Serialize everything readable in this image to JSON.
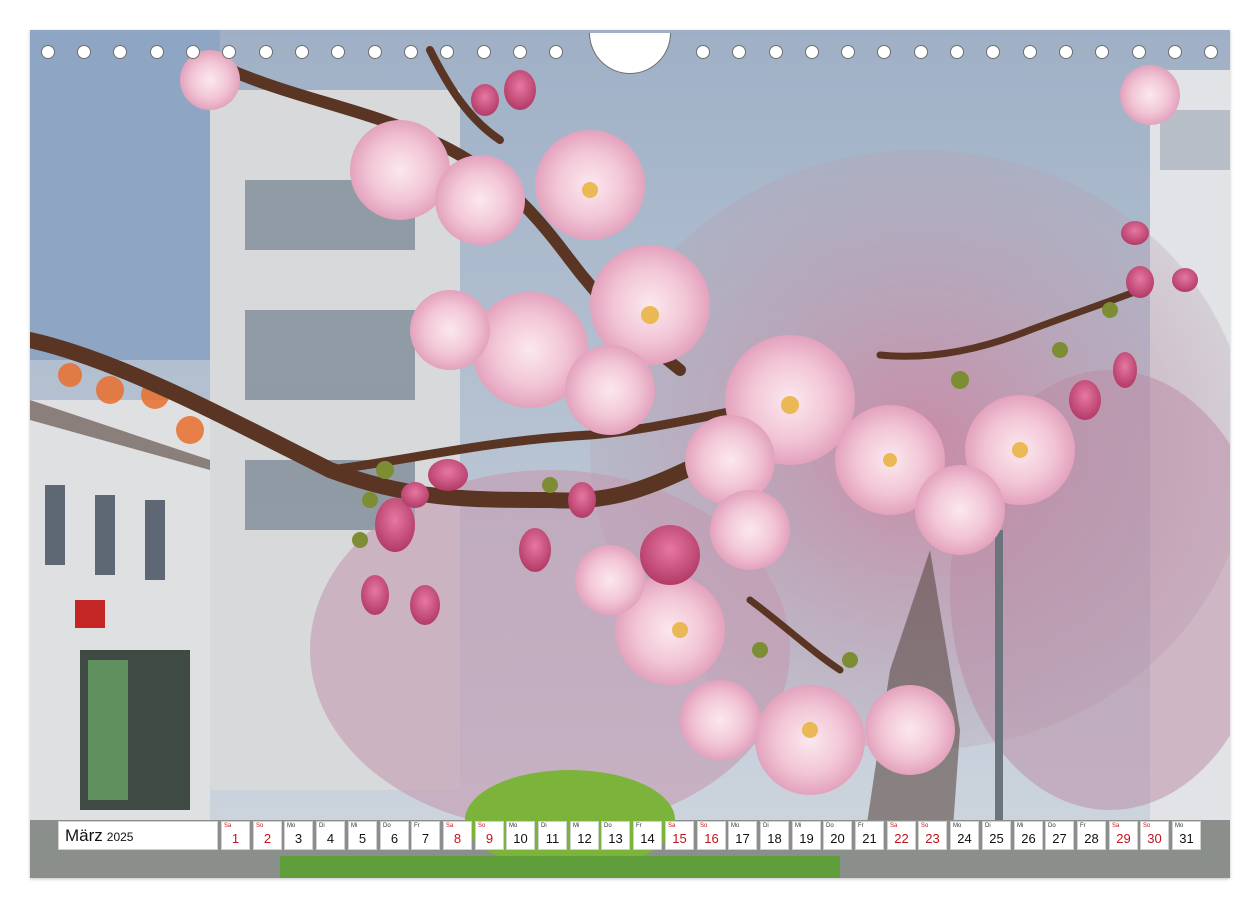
{
  "calendar": {
    "month": "März",
    "year": "2025",
    "days": [
      {
        "dow": "Sa",
        "num": "1",
        "weekend": true
      },
      {
        "dow": "So",
        "num": "2",
        "weekend": true
      },
      {
        "dow": "Mo",
        "num": "3",
        "weekend": false
      },
      {
        "dow": "Di",
        "num": "4",
        "weekend": false
      },
      {
        "dow": "Mi",
        "num": "5",
        "weekend": false
      },
      {
        "dow": "Do",
        "num": "6",
        "weekend": false
      },
      {
        "dow": "Fr",
        "num": "7",
        "weekend": false
      },
      {
        "dow": "Sa",
        "num": "8",
        "weekend": true
      },
      {
        "dow": "So",
        "num": "9",
        "weekend": true
      },
      {
        "dow": "Mo",
        "num": "10",
        "weekend": false
      },
      {
        "dow": "Di",
        "num": "11",
        "weekend": false
      },
      {
        "dow": "Mi",
        "num": "12",
        "weekend": false
      },
      {
        "dow": "Do",
        "num": "13",
        "weekend": false
      },
      {
        "dow": "Fr",
        "num": "14",
        "weekend": false
      },
      {
        "dow": "Sa",
        "num": "15",
        "weekend": true
      },
      {
        "dow": "So",
        "num": "16",
        "weekend": true
      },
      {
        "dow": "Mo",
        "num": "17",
        "weekend": false
      },
      {
        "dow": "Di",
        "num": "18",
        "weekend": false
      },
      {
        "dow": "Mi",
        "num": "19",
        "weekend": false
      },
      {
        "dow": "Do",
        "num": "20",
        "weekend": false
      },
      {
        "dow": "Fr",
        "num": "21",
        "weekend": false
      },
      {
        "dow": "Sa",
        "num": "22",
        "weekend": true
      },
      {
        "dow": "So",
        "num": "23",
        "weekend": true
      },
      {
        "dow": "Mo",
        "num": "24",
        "weekend": false
      },
      {
        "dow": "Di",
        "num": "25",
        "weekend": false
      },
      {
        "dow": "Mi",
        "num": "26",
        "weekend": false
      },
      {
        "dow": "Do",
        "num": "27",
        "weekend": false
      },
      {
        "dow": "Fr",
        "num": "28",
        "weekend": false
      },
      {
        "dow": "Sa",
        "num": "29",
        "weekend": true
      },
      {
        "dow": "So",
        "num": "30",
        "weekend": true
      },
      {
        "dow": "Mo",
        "num": "31",
        "weekend": false
      }
    ]
  },
  "colors": {
    "weekend": "#c0141b",
    "blossom": "#f2c6d6",
    "blossom_deep": "#d9779e",
    "branch": "#5a3524",
    "sky": "#a9b7c9"
  }
}
